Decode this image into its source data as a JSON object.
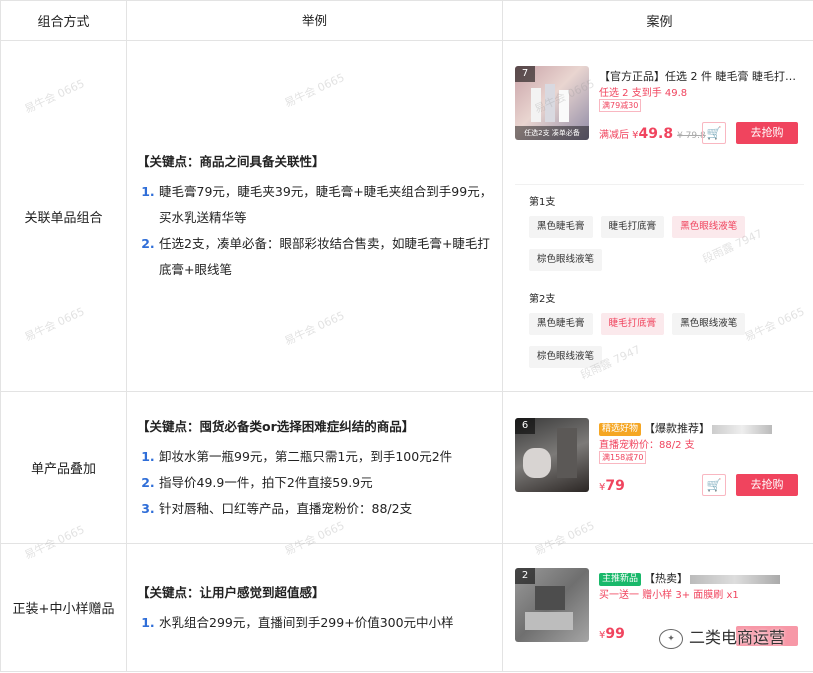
{
  "header": {
    "col1": "组合方式",
    "col2": "举例",
    "col3": "案例"
  },
  "rows": [
    {
      "method": "关联单品组合",
      "key": "【关键点：商品之间具备关联性】",
      "items": [
        "睫毛膏79元，睫毛夹39元，睫毛膏+睫毛夹组合到手99元，买水乳送精华等",
        "任选2支，凑单必备：眼部彩妆结合售卖，如睫毛膏+睫毛打底膏+眼线笔"
      ],
      "card": {
        "num": "7",
        "caption": "任选2支 凑单必备",
        "title": "【官方正品】任选 2 件 睫毛膏 睫毛打…",
        "subtitle": "任选 2 支到手 49.8",
        "badge": "满79减30",
        "price_prefix": "满减后 ¥",
        "price": "49.8",
        "old_price": "¥ 79.8",
        "buy": "去抢购"
      },
      "spec1_title": "第1支",
      "spec1_chips": [
        "黑色睫毛膏",
        "睫毛打底膏",
        "黑色眼线液笔",
        "棕色眼线液笔"
      ],
      "spec2_title": "第2支",
      "spec2_chips": [
        "黑色睫毛膏",
        "睫毛打底膏",
        "黑色眼线液笔",
        "棕色眼线液笔"
      ]
    },
    {
      "method": "单产品叠加",
      "key": "【关键点：囤货必备类or选择困难症纠结的商品】",
      "items": [
        "卸妆水第一瓶99元，第二瓶只需1元，到手100元2件",
        "指导价49.9一件，拍下2件直接59.9元",
        "针对唇釉、口红等产品，直播宠粉价：88/2支"
      ],
      "card": {
        "num": "6",
        "tag": "精选好物",
        "title": "【爆款推荐】",
        "subtitle": "直播宠粉价：88/2 支",
        "badge": "满158减70",
        "price_prefix": "¥",
        "price": "79",
        "buy": "去抢购"
      }
    },
    {
      "method": "正装+中小样赠品",
      "key": "【关键点：让用户感觉到超值感】",
      "items": [
        "水乳组合299元，直播间到手299+价值300元中小样"
      ],
      "card": {
        "num": "2",
        "tag": "主推新品",
        "title": "【热卖】",
        "subtitle": "买一送一 赠小样 3+ 面膜刷 x1",
        "price_prefix": "¥",
        "price": "99"
      }
    }
  ],
  "watermarks": [
    "易牛会 0665",
    "段雨露 7947"
  ],
  "wechat_account": "二类电商运营",
  "colors": {
    "accent": "#f0445e",
    "list_number": "#2f6ed8"
  }
}
